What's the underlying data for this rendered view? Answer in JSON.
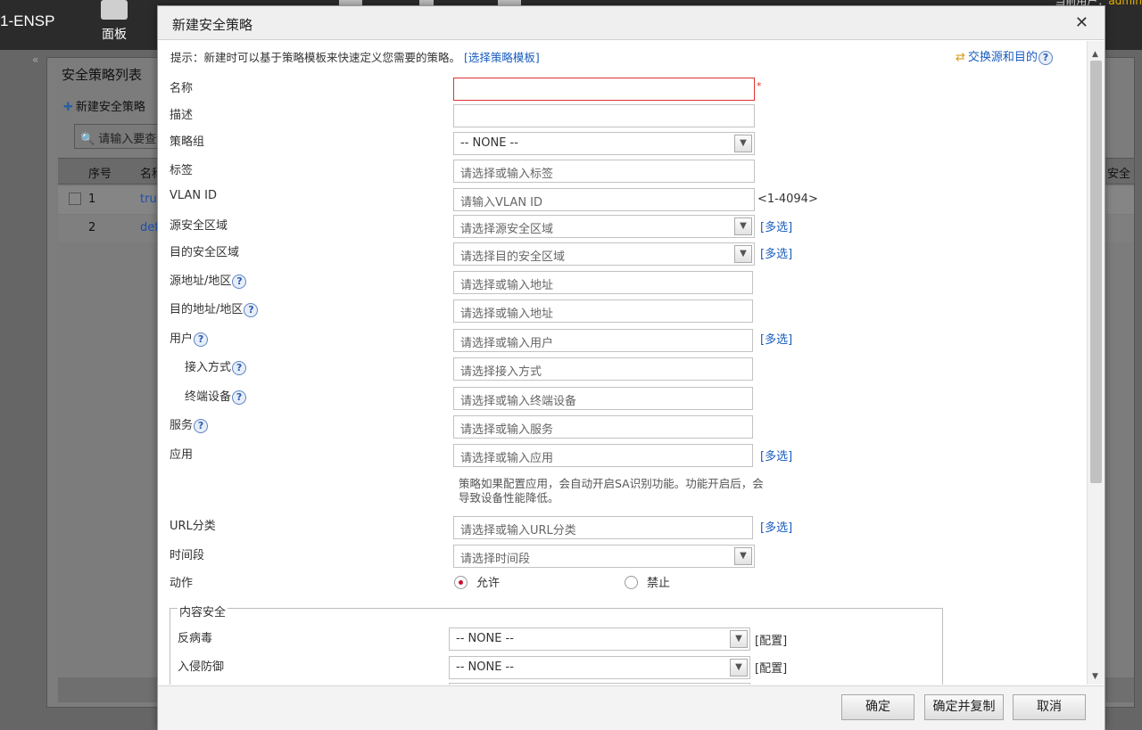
{
  "app": {
    "brand": "1-ENSP",
    "nav_panel": "面板",
    "user_prefix": "当前用户：",
    "user_name": "admin"
  },
  "background": {
    "panel_title": "安全策略列表",
    "add_button": "新建安全策略",
    "search_placeholder": "请输入要查询的内容",
    "columns": {
      "index": "序号",
      "name": "名称",
      "security": "安全"
    },
    "rows": [
      {
        "index": "1",
        "name": "trust"
      },
      {
        "index": "2",
        "name": "default"
      }
    ]
  },
  "dialog": {
    "title": "新建安全策略",
    "close_icon": "close-icon",
    "tip_text": "提示：新建时可以基于策略模板来快速定义您需要的策略。",
    "tip_link": "[选择策略模板]",
    "swap_label": "交换源和目的",
    "fields": {
      "name": {
        "label": "名称",
        "value": "",
        "required_mark": "*"
      },
      "description": {
        "label": "描述",
        "value": ""
      },
      "policy_group": {
        "label": "策略组",
        "selected": "-- NONE --"
      },
      "tag": {
        "label": "标签",
        "placeholder": "请选择或输入标签"
      },
      "vlan_id": {
        "label": "VLAN ID",
        "placeholder": "请输入VLAN ID",
        "range_hint": "<1-4094>"
      },
      "src_zone": {
        "label": "源安全区域",
        "placeholder": "请选择源安全区域",
        "multi": "[多选]"
      },
      "dst_zone": {
        "label": "目的安全区域",
        "placeholder": "请选择目的安全区域",
        "multi": "[多选]"
      },
      "src_addr": {
        "label": "源地址/地区",
        "placeholder": "请选择或输入地址"
      },
      "dst_addr": {
        "label": "目的地址/地区",
        "placeholder": "请选择或输入地址"
      },
      "user": {
        "label": "用户",
        "placeholder": "请选择或输入用户",
        "multi": "[多选]"
      },
      "access_mode": {
        "label": "接入方式",
        "placeholder": "请选择接入方式"
      },
      "terminal": {
        "label": "终端设备",
        "placeholder": "请选择或输入终端设备"
      },
      "service": {
        "label": "服务",
        "placeholder": "请选择或输入服务"
      },
      "application": {
        "label": "应用",
        "placeholder": "请选择或输入应用",
        "multi": "[多选]"
      },
      "app_note": "策略如果配置应用，会自动开启SA识别功能。功能开启后，会导致设备性能降低。",
      "url_category": {
        "label": "URL分类",
        "placeholder": "请选择或输入URL分类",
        "multi": "[多选]"
      },
      "time_range": {
        "label": "时间段",
        "placeholder": "请选择时间段"
      },
      "action": {
        "label": "动作",
        "permit": "允许",
        "deny": "禁止",
        "selected": "permit"
      }
    },
    "content_security": {
      "legend": "内容安全",
      "antivirus": {
        "label": "反病毒",
        "selected": "-- NONE --",
        "config": "[配置]"
      },
      "ips": {
        "label": "入侵防御",
        "selected": "-- NONE --",
        "config": "[配置]"
      }
    },
    "buttons": {
      "ok": "确定",
      "ok_copy": "确定并复制",
      "cancel": "取消"
    }
  },
  "colors": {
    "link": "#1a5dbf",
    "required_border": "#e03232",
    "radio_on": "#c8102e"
  }
}
